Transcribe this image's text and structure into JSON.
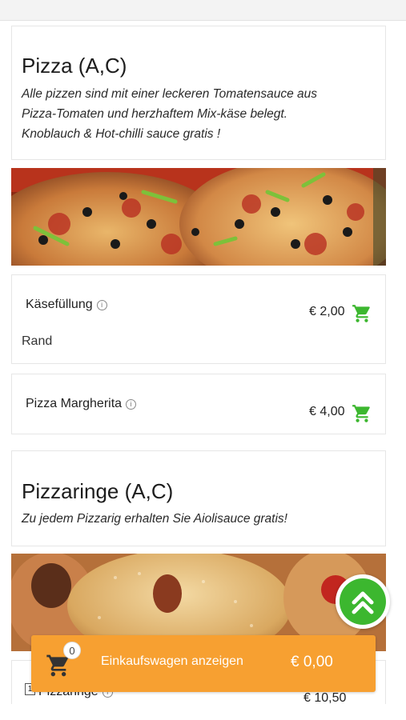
{
  "categories": [
    {
      "title": "Pizza (A,C)",
      "description_lines": [
        "Alle pizzen sind mit einer leckeren Tomatensauce aus",
        "Pizza-Tomaten und herzhaftem Mix-käse belegt.",
        "Knoblauch & Hot-chilli sauce gratis !"
      ]
    },
    {
      "title": "Pizzaringe (A,C)",
      "description_lines": [
        "Zu jedem Pizzarig erhalten Sie Aiolisauce gratis!"
      ]
    }
  ],
  "items": [
    {
      "name": "Käsefüllung",
      "info_icon": "ⓘ",
      "price": "€ 2,00",
      "sub_label": "Rand"
    },
    {
      "name": "Pizza Margherita",
      "info_icon": "ⓘ",
      "price": "€ 4,00"
    },
    {
      "name": "Pizzaringe",
      "info_icon": "ⓘ",
      "price": "€ 10,50",
      "number": "1"
    }
  ],
  "cart": {
    "count": "0",
    "label": "Einkaufswagen anzeigen",
    "total": "€ 0,00"
  },
  "icons": {
    "cart": "shopping-cart-icon",
    "scroll_top": "double-chevron-up-icon",
    "info": "info-icon"
  },
  "colors": {
    "accent_green": "#3cb72f",
    "cart_bar": "#f7a031"
  }
}
